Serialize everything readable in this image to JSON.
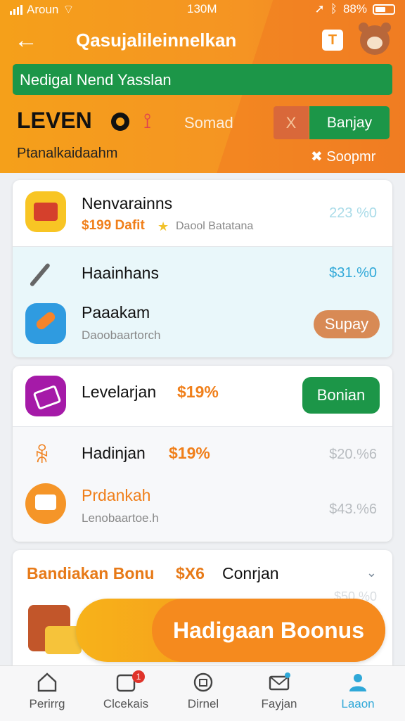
{
  "status": {
    "carrier": "Aroun",
    "time": "130M",
    "battery": "88%"
  },
  "header": {
    "title": "Qasujalileinnelkan",
    "notice": "Nedigal Nend Yasslan",
    "level_label": "LEVEN",
    "somad": "Somad",
    "x_label": "X",
    "banjay": "Banjay",
    "subtitle": "Ptanalkaidaahm",
    "soopmr": "Soopmr"
  },
  "card1": {
    "items": [
      {
        "title": "Nenvarainns",
        "promo": "$199 Dafit",
        "star_text": "Daool Batatana",
        "price": "223 %0"
      },
      {
        "title": "Haainhans",
        "price": "$31.%0"
      },
      {
        "title": "Paaakam",
        "desc": "Daoobaartorch",
        "button": "Supay"
      }
    ]
  },
  "card2": {
    "items": [
      {
        "title": "Levelarjan",
        "discount": "$19%",
        "button": "Bonian"
      },
      {
        "title": "Hadinjan",
        "discount": "$19%",
        "price": "$20.%6"
      },
      {
        "title": "Prdankah",
        "desc": "Lenobaartoe.h",
        "price": "$43.%6"
      }
    ]
  },
  "bonus": {
    "title": "Bandiakan Bonu",
    "mid": "$X6",
    "end": "Conrjan",
    "faded_price": "$50.%0",
    "cta": "Hadigaan Boonus"
  },
  "tabs": [
    {
      "label": "Perirrg",
      "icon": "home-icon"
    },
    {
      "label": "Clcekais",
      "icon": "cards-icon",
      "badge": "1"
    },
    {
      "label": "Dirnel",
      "icon": "package-icon"
    },
    {
      "label": "Fayjan",
      "icon": "mail-icon"
    },
    {
      "label": "Laaon",
      "icon": "person-icon"
    }
  ],
  "colors": {
    "primary_orange": "#f5a01a",
    "green": "#1c9648",
    "accent_blue": "#2fa8d8"
  }
}
